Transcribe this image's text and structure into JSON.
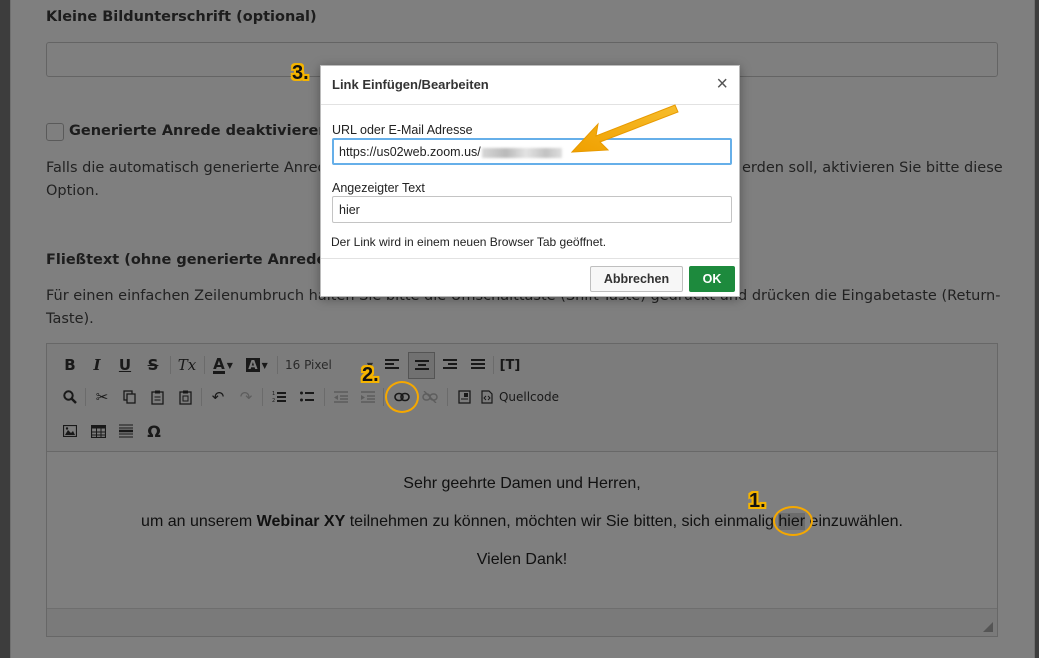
{
  "form": {
    "caption_label": "Kleine Bildunterschrift (optional)",
    "salutation_checkbox_label": "Generierte Anrede deaktivieren",
    "salutation_help": "Falls die automatisch generierte Anrede nicht in Ihren Text eingefügt werden soll, aktivieren Sie bitte diese Option.",
    "salutation_help_line1_left": "Falls die automatisch generierte Anrede",
    "salutation_help_line1_right": "erden soll, aktivieren Sie bitte diese",
    "salutation_help_line2": "Option.",
    "body_label": "Fließtext (ohne generierte Anrede)",
    "body_help_line1": "Für einen einfachen Zeilenumbruch halten Sie bitte die Umschalttaste (Shift-Taste) gedrückt und drücken die Eingabetaste (Return-",
    "body_help_line2": "Taste)."
  },
  "editor": {
    "font_size": "16 Pixel",
    "source_label": "Quellcode",
    "bold": "B",
    "italic": "I",
    "underline": "U",
    "strike": "S",
    "clear_format": "Tx",
    "omega": "Ω",
    "content": {
      "line1": "Sehr geehrte Damen und Herren,",
      "line2_a": "um an unserem ",
      "line2_b": "Webinar XY",
      "line2_c": " teilnehmen zu können, möchten wir Sie bitten, sich einmalig ",
      "line2_link": "hier",
      "line2_d": " einzuwählen.",
      "line3": "Vielen Dank!"
    }
  },
  "dialog": {
    "title": "Link Einfügen/Bearbeiten",
    "close": "×",
    "url_label": "URL oder E-Mail Adresse",
    "url_value": "https://us02web.zoom.us/",
    "text_label": "Angezeigter Text",
    "text_value": "hier",
    "note": "Der Link wird in einem neuen Browser Tab geöffnet.",
    "cancel": "Abbrechen",
    "ok": "OK"
  },
  "annotations": {
    "step1": "1.",
    "step2": "2.",
    "step3": "3.",
    "color": "#f5a800"
  }
}
